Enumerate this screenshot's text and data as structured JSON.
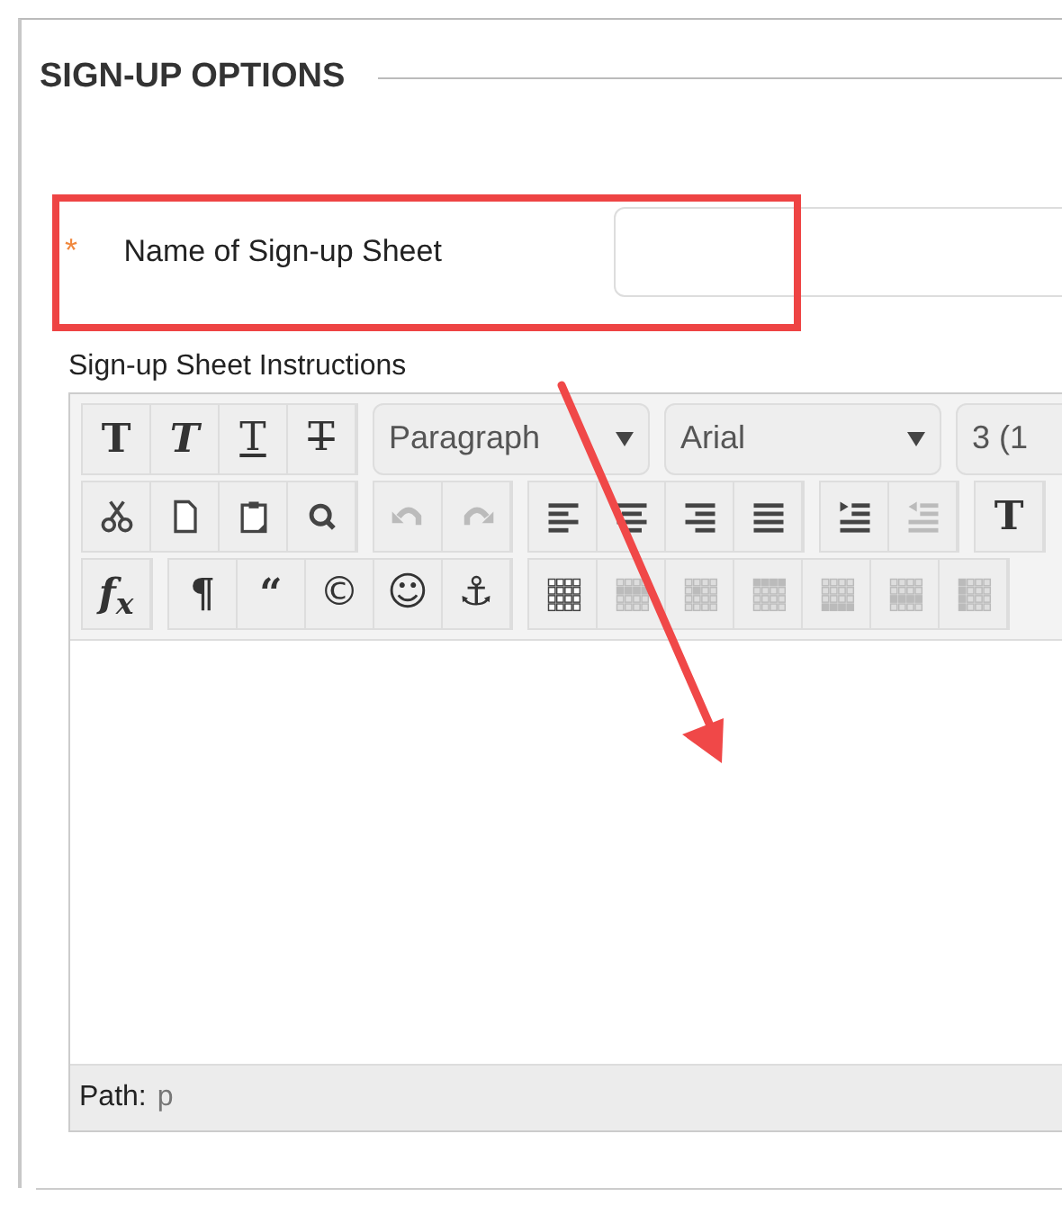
{
  "section": {
    "title": "SIGN-UP OPTIONS"
  },
  "name_field": {
    "required_mark": "*",
    "label": "Name of Sign-up Sheet"
  },
  "instructions": {
    "label": "Sign-up Sheet Instructions"
  },
  "editor": {
    "toolbar_rows": [
      [
        {
          "kind": "buttons",
          "buttons": [
            {
              "glyph": "T",
              "disabled": false
            },
            {
              "glyph": "T",
              "disabled": false
            },
            {
              "glyph": "T",
              "disabled": false
            },
            {
              "glyph": "T",
              "disabled": false
            }
          ]
        },
        {
          "kind": "select",
          "value": "Paragraph",
          "caret": true
        },
        {
          "kind": "select",
          "value": "Arial",
          "caret": true
        },
        {
          "kind": "select",
          "value": "3 (1",
          "caret": false
        }
      ],
      [
        {
          "kind": "buttons",
          "buttons": [
            {
              "disabled": false
            },
            {
              "disabled": false
            },
            {
              "disabled": false
            },
            {
              "disabled": false
            }
          ]
        },
        {
          "kind": "buttons",
          "buttons": [
            {
              "disabled": true
            },
            {
              "disabled": true
            }
          ]
        },
        {
          "kind": "buttons",
          "buttons": [
            {
              "disabled": false
            },
            {
              "disabled": false
            },
            {
              "disabled": false
            },
            {
              "disabled": false
            }
          ]
        },
        {
          "kind": "buttons",
          "buttons": [
            {
              "disabled": false
            },
            {
              "disabled": true
            }
          ]
        },
        {
          "kind": "buttons",
          "buttons": [
            {
              "glyph": "T",
              "disabled": false
            }
          ]
        }
      ],
      [
        {
          "kind": "buttons",
          "buttons": [
            {
              "glyph": "f$_{x}$",
              "disabled": false
            }
          ]
        },
        {
          "kind": "buttons",
          "buttons": [
            {
              "glyph": "¶",
              "disabled": false
            },
            {
              "glyph": "“",
              "disabled": false
            },
            {
              "glyph": "©",
              "disabled": false
            },
            {
              "glyph": "☺",
              "disabled": false
            },
            {
              "glyph": "⚓",
              "disabled": false
            }
          ]
        },
        {
          "kind": "buttons",
          "buttons": [
            {
              "disabled": false
            },
            {
              "disabled": true
            },
            {
              "disabled": true
            },
            {
              "disabled": true
            },
            {
              "disabled": true
            },
            {
              "disabled": true
            },
            {
              "disabled": true
            }
          ]
        }
      ]
    ],
    "path_label": "Path:",
    "path_value": "p"
  },
  "annotations": {
    "highlight_frame": true,
    "arrow": true
  }
}
